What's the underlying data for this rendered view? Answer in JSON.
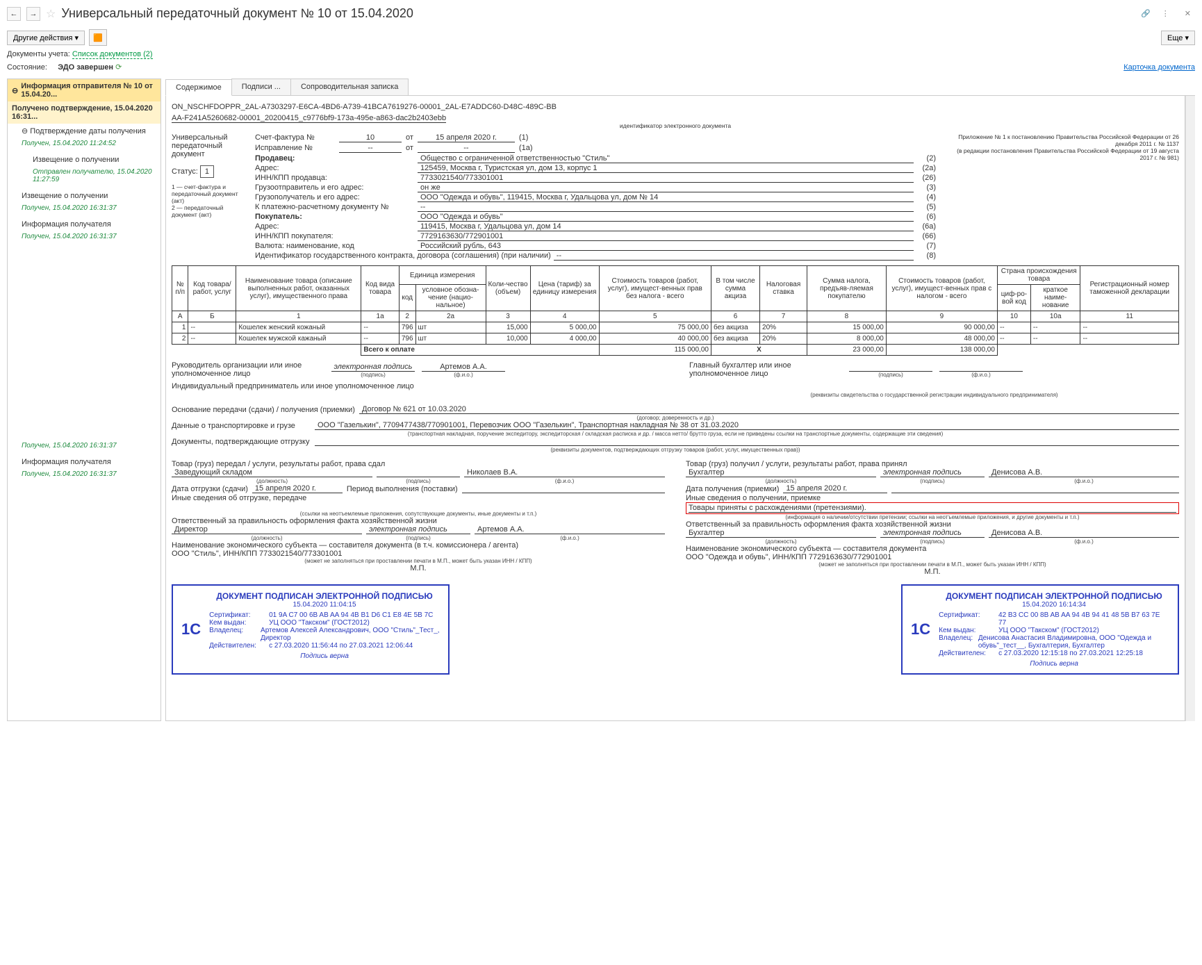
{
  "title": "Универсальный передаточный документ № 10 от 15.04.2020",
  "toolbar": {
    "other_actions": "Другие действия",
    "more": "Еще"
  },
  "docs_account": {
    "label": "Документы учета:",
    "link": "Список документов (2)"
  },
  "state": {
    "label": "Состояние:",
    "value": "ЭДО завершен",
    "doc_card": "Карточка документа"
  },
  "sidebar": {
    "header": "Информация отправителя № 10 от 15.04.20...",
    "subheader": "Получено подтверждение, 15.04.2020 16:31...",
    "items": [
      {
        "label": "Подтверждение даты получения",
        "status": "Получен, 15.04.2020 11:24:52",
        "indent": false
      },
      {
        "label": "Извещение о получении",
        "status": "Отправлен получателю, 15.04.2020 11:27:59",
        "indent": true
      },
      {
        "label": "Извещение о получении",
        "status": "Получен, 15.04.2020 16:31:37",
        "indent": false
      },
      {
        "label": "Информация получателя",
        "status": "Получен, 15.04.2020 16:31:37",
        "indent": false
      },
      {
        "label": "",
        "status": "Получен, 15.04.2020 16:31:37",
        "indent": false,
        "gap": true
      },
      {
        "label": "Информация получателя",
        "status": "Получен, 15.04.2020 16:31:37",
        "indent": false
      }
    ]
  },
  "tabs": [
    "Содержимое",
    "Подписи ...",
    "Сопроводительная записка"
  ],
  "doc": {
    "filename": "ON_NSCHFDOPPR_2AL-A7303297-E6CA-4BD6-A739-41BCA7619276-00001_2AL-E7ADDC60-D48C-489C-BB",
    "filename2": "AA-F241A5260682-00001_20200415_c9776bf9-173a-495e-a863-dac2b2403ebb",
    "id_hint": "идентификатор электронного документа",
    "left_block": "Универсальный передаточный документ",
    "status_label": "Статус:",
    "status_val": "1",
    "status_desc": "1 — счет-фактура и передаточный документ (акт)\n2 — передаточный документ (акт)",
    "appendix": "Приложение № 1 к постановлению Правительства Российской Федерации от 26 декабря 2011 г. № 1137\n(в редакции постановления Правительства Российской Федерации от 19 августа 2017 г. № 981)",
    "sf": {
      "num_label": "Счет-фактура №",
      "num": "10",
      "date_from": "от",
      "date": "15 апреля 2020 г.",
      "n1": "(1)",
      "corr_label": "Исправление №",
      "corr_num": "--",
      "corr_date": "--",
      "n1a": "(1а)"
    },
    "fields": [
      {
        "k": "Продавец:",
        "v": "Общество с ограниченной ответственностью \"Стиль\"",
        "n": "(2)",
        "bold": true
      },
      {
        "k": "Адрес:",
        "v": "125459, Москва г, Туристская ул, дом 13, корпус 1",
        "n": "(2а)"
      },
      {
        "k": "ИНН/КПП продавца:",
        "v": "7733021540/773301001",
        "n": "(26)"
      },
      {
        "k": "Грузоотправитель и его адрес:",
        "v": "он же",
        "n": "(3)"
      },
      {
        "k": "Грузополучатель и его адрес:",
        "v": "ООО \"Одежда и обувь\", 119415, Москва г, Удальцова ул, дом № 14",
        "n": "(4)"
      },
      {
        "k": "К платежно-расчетному документу №",
        "v": "--",
        "n": "(5)"
      },
      {
        "k": "Покупатель:",
        "v": "ООО \"Одежда и обувь\"",
        "n": "(6)",
        "bold": true
      },
      {
        "k": "Адрес:",
        "v": "119415, Москва г, Удальцова ул, дом 14",
        "n": "(6а)"
      },
      {
        "k": "ИНН/КПП покупателя:",
        "v": "7729163630/772901001",
        "n": "(66)"
      },
      {
        "k": "Валюта: наименование, код",
        "v": "Российский рубль, 643",
        "n": "(7)"
      },
      {
        "k": "Идентификатор государственного контракта, договора (соглашения) (при наличии)",
        "v": "--",
        "n": "(8)"
      }
    ],
    "table": {
      "headers": {
        "np": "№ п/п",
        "code": "Код товара/ работ, услуг",
        "name": "Наименование товара (описание выполненных работ, оказанных услуг), имущественного права",
        "kind": "Код вида товара",
        "unit": "Единица измерения",
        "unit_code": "код",
        "unit_name": "условное обозна-чение (нацио-нальное)",
        "qty": "Коли-чество (объем)",
        "price": "Цена (тариф) за единицу измерения",
        "cost": "Стоимость товаров (работ, услуг), имущест-венных прав без налога - всего",
        "excise": "В том числе сумма акциза",
        "rate": "Налоговая ставка",
        "tax": "Сумма налога, предъяв-ляемая покупателю",
        "total": "Стоимость товаров (работ, услуг), имущест-венных прав с налогом - всего",
        "country": "Страна происхождения товара",
        "c_code": "циф-ро-вой код",
        "c_name": "краткое наиме-нование",
        "decl": "Регистрационный номер таможенной декларации"
      },
      "colnums": [
        "А",
        "Б",
        "1",
        "1а",
        "2",
        "2а",
        "3",
        "4",
        "5",
        "6",
        "7",
        "8",
        "9",
        "10",
        "10а",
        "11"
      ],
      "rows": [
        {
          "n": "1",
          "code": "--",
          "name": "Кошелек женский кожаный",
          "kind": "--",
          "uc": "796",
          "un": "шт",
          "qty": "15,000",
          "price": "5 000,00",
          "cost": "75 000,00",
          "exc": "без акциза",
          "rate": "20%",
          "tax": "15 000,00",
          "total": "90 000,00",
          "cc": "--",
          "cn": "--",
          "decl": "--"
        },
        {
          "n": "2",
          "code": "--",
          "name": "Кошелек мужской кажаный",
          "kind": "--",
          "uc": "796",
          "un": "шт",
          "qty": "10,000",
          "price": "4 000,00",
          "cost": "40 000,00",
          "exc": "без акциза",
          "rate": "20%",
          "tax": "8 000,00",
          "total": "48 000,00",
          "cc": "--",
          "cn": "--",
          "decl": "--"
        }
      ],
      "totals": {
        "label": "Всего к оплате",
        "cost": "115 000,00",
        "x": "X",
        "tax": "23 000,00",
        "total": "138 000,00"
      }
    },
    "sig": {
      "head_org": "Руководитель организации или иное уполномоченное лицо",
      "chief_acc": "Главный бухгалтер или иное уполномоченное лицо",
      "esign": "электронная подпись",
      "artemov": "Артемов А.А.",
      "indiv": "Индивидуальный предприниматель или иное уполномоченное лицо",
      "req_hint": "(реквизиты свидетельства о государственной  регистрации индивидуального предпринимателя)",
      "pod": "(подпись)",
      "fio": "(ф.и.о.)"
    },
    "basis": {
      "l": "Основание передачи (сдачи) / получения (приемки)",
      "v": "Договор № 621 от 10.03.2020",
      "h": "(договор; доверенность и др.)"
    },
    "transport": {
      "l": "Данные о транспортировке и грузе",
      "v": "ООО \"Газелькин\", 7709477438/770901001, Перевозчик ООО \"Газелькин\", Транспортная накладная № 38 от 31.03.2020",
      "h": "(транспортная накладная, поручение экспедитору, экспедиторская / складская расписка и др. / масса нетто/ брутто груза, если не приведены ссылки на транспортные документы, содержащие эти сведения)"
    },
    "ship_docs": {
      "l": "Документы, подтверждающие отгрузку",
      "v": "",
      "h": "(реквизиты документов, подтверждающих отгрузку товаров (работ, услуг, имущественных прав))"
    },
    "left_bottom": {
      "gave": "Товар (груз) передал / услуги, результаты работ, права сдал",
      "pos": "Заведующий складом",
      "name": "Николаев В.А.",
      "ship_date_l": "Дата отгрузки (сдачи)",
      "ship_date": "15 апреля 2020 г.",
      "period_l": "Период выполнения (поставки)",
      "other": "Иные сведения об отгрузке, передаче",
      "other_h": "(ссылки на неотъемлемые приложения, сопутствующие  документы, иные документы и т.п.)",
      "resp": "Ответственный за правильность оформления факта хозяйственной жизни",
      "resp_pos": "Директор",
      "resp_sign": "электронная подпись",
      "resp_name": "Артемов А.А.",
      "econ": "Наименование экономического субъекта — составителя документа (в т.ч. комиссионера / агента)",
      "econ_v": "ООО \"Стиль\", ИНН/КПП 7733021540/773301001",
      "econ_h": "(может не заполняться при проставлении печати в М.П., может быть указан ИНН / КПП)",
      "mp": "М.П."
    },
    "right_bottom": {
      "got": "Товар (груз) получил / услуги, результаты работ, права принял",
      "pos": "Бухгалтер",
      "sign": "электронная подпись",
      "name": "Денисова А.В.",
      "recv_date_l": "Дата получения (приемки)",
      "recv_date": "15 апреля 2020 г.",
      "other": "Иные сведения о получении, приемке",
      "claim": "Товары приняты с расхождениями (претензиями).",
      "other_h": "(информация о наличии/отсутствии претензии; ссылки на неотъемлемые приложения,  и другие  документы и т.п.)",
      "resp": "Ответственный за правильность оформления факта хозяйственной жизни",
      "resp_pos": "Бухгалтер",
      "resp_sign": "электронная подпись",
      "resp_name": "Денисова А.В.",
      "econ": "Наименование экономического субъекта — составителя документа",
      "econ_v": "ООО \"Одежда и обувь\", ИНН/КПП 7729163630/772901001",
      "econ_h": "(может не заполняться при проставлении печати в М.П., может быть указан ИНН / КПП)",
      "mp": "М.П."
    },
    "hints": {
      "pos": "(должность)",
      "sign": "(подпись)",
      "fio": "(ф.и.о.)"
    },
    "stamps": [
      {
        "title": "ДОКУМЕНТ ПОДПИСАН ЭЛЕКТРОННОЙ ПОДПИСЬЮ",
        "date": "15.04.2020 11:04:15",
        "cert_l": "Сертификат:",
        "cert": "01 9A C7 00 6B AB AA 94 4B B1 D6 C1 E8 4E 5B 7C",
        "iss_l": "Кем выдан:",
        "iss": "УЦ ООО \"Такском\" (ГОСТ2012)",
        "own_l": "Владелец:",
        "own": "Артемов Алексей Александрович, ООО \"Стиль\"_Тест_, Директор",
        "valid_l": "Действителен:",
        "valid": "с 27.03.2020 11:56:44 по 27.03.2021 12:06:44",
        "foot": "Подпись верна"
      },
      {
        "title": "ДОКУМЕНТ ПОДПИСАН ЭЛЕКТРОННОЙ ПОДПИСЬЮ",
        "date": "15.04.2020 16:14:34",
        "cert_l": "Сертификат:",
        "cert": "42 B3 CC 00 8B AB AA 94 4B 94 41 48 5B B7 63 7E 77",
        "iss_l": "Кем выдан:",
        "iss": "УЦ ООО \"Такском\" (ГОСТ2012)",
        "own_l": "Владелец:",
        "own": "Денисова Анастасия Владимировна, ООО \"Одежда и обувь\"_тест__, Бухгалтерия, Бухгалтер",
        "valid_l": "Действителен:",
        "valid": "с 27.03.2020 12:15:18 по 27.03.2021 12:25:18",
        "foot": "Подпись верна"
      }
    ]
  }
}
